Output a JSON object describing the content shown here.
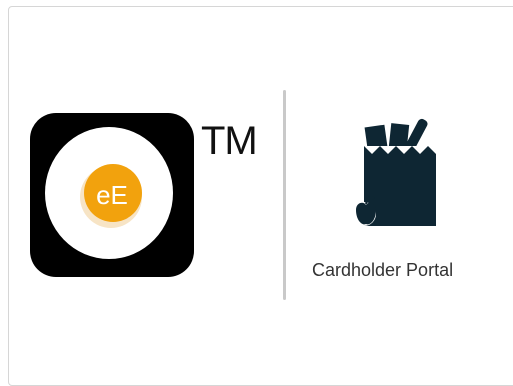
{
  "brand": {
    "logo_icon": "ebt-edge-egg-logo",
    "logo_text": "eE",
    "trademark": "TM"
  },
  "portal": {
    "icon": "grocery-bag-icon",
    "label": "Cardholder Portal"
  },
  "colors": {
    "logo_black": "#000000",
    "yolk_orange": "#f2a20d",
    "bag_navy": "#0e2633",
    "divider_gray": "#c9c9c9",
    "label_text": "#333333"
  }
}
